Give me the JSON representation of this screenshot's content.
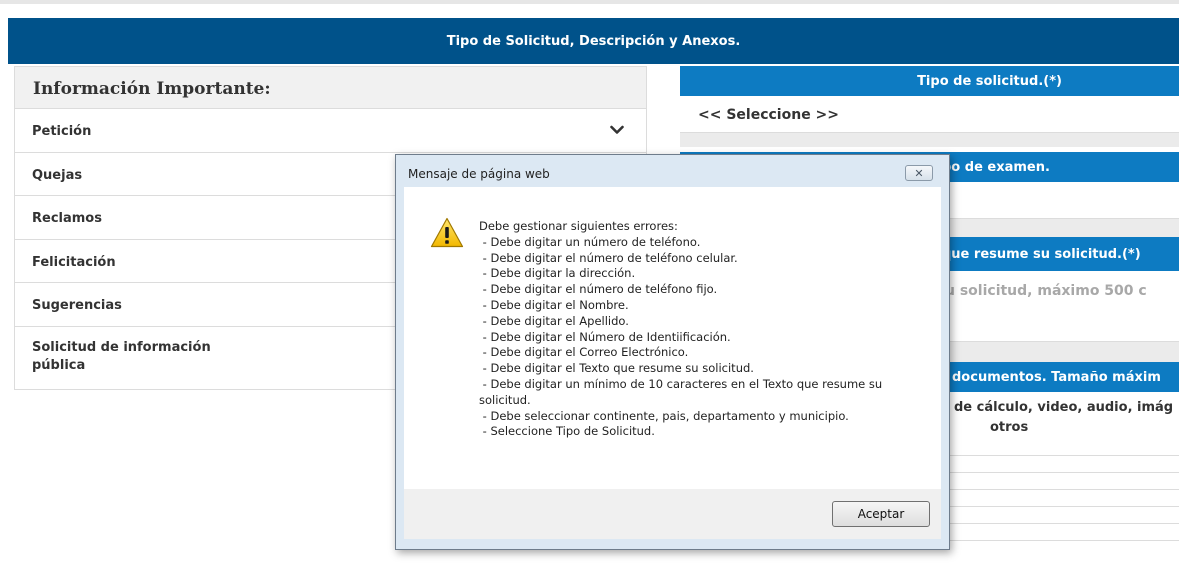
{
  "header": {
    "title": "Tipo de Solicitud, Descripción y Anexos."
  },
  "left_panel": {
    "title": "Información Importante:",
    "items": [
      {
        "label": "Petición",
        "icon": "chevron-down-icon"
      },
      {
        "label": "Quejas"
      },
      {
        "label": "Reclamos"
      },
      {
        "label": "Felicitación"
      },
      {
        "label": "Sugerencias"
      },
      {
        "label": "Solicitud de información pública"
      }
    ]
  },
  "right_panel": {
    "tipo_solicitud_header": "Tipo de solicitud.(*)",
    "tipo_solicitud_value": "<< Seleccione >>",
    "tipo_examen_header": "po de examen.",
    "texto_header": "que resume su solicitud.(*)",
    "texto_placeholder": "u solicitud, máximo 500 c",
    "documentos_header": "documentos. Tamaño máxim",
    "documentos_desc": "de cálculo, video, audio, imág",
    "documentos_desc2": "otros"
  },
  "dialog": {
    "title": "Mensaje de página web",
    "icon": "warning-icon",
    "message": "Debe gestionar siguientes errores:\n - Debe digitar un número de teléfono.\n - Debe digitar el número de teléfono celular.\n - Debe digitar la dirección.\n - Debe digitar el número de teléfono fijo.\n - Debe digitar el Nombre.\n - Debe digitar el Apellido.\n - Debe digitar el Número de Identiificación.\n - Debe digitar el Correo Electrónico.\n - Debe digitar el Texto que resume su solicitud.\n - Debe digitar un mínimo de 10 caracteres en el Texto que resume su solicitud.\n - Debe seleccionar continente, pais, departamento y municipio.\n - Seleccione Tipo de Solicitud.",
    "accept_label": "Aceptar"
  },
  "colors": {
    "header_bg": "#00528a",
    "section_header_bg": "#0d7bc2",
    "dialog_frame": "#dce8f3"
  }
}
